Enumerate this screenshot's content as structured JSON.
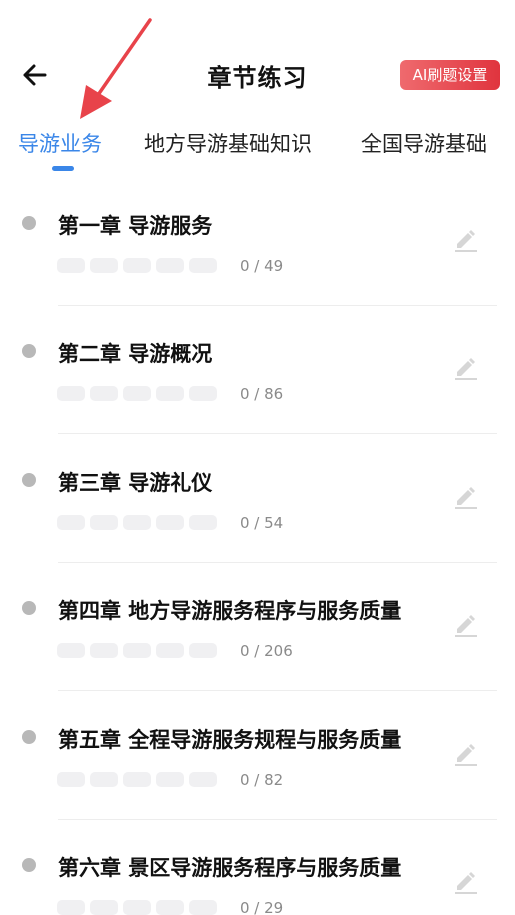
{
  "header": {
    "back_icon": "back-arrow-icon",
    "title": "章节练习",
    "ai_button": "AI刷题设置",
    "ai_button_color": "#e0343e"
  },
  "tabs": [
    {
      "label": "导游业务",
      "active": true
    },
    {
      "label": "地方导游基础知识",
      "active": false
    },
    {
      "label": "全国导游基础",
      "active": false
    }
  ],
  "accent_color": "#3a86e8",
  "chapters": [
    {
      "title": "第一章 导游服务",
      "count": "0 / 49"
    },
    {
      "title": "第二章 导游概况",
      "count": "0 / 86"
    },
    {
      "title": "第三章 导游礼仪",
      "count": "0 / 54"
    },
    {
      "title": "第四章 地方导游服务程序与服务质量",
      "count": "0 / 206"
    },
    {
      "title": "第五章 全程导游服务规程与服务质量",
      "count": "0 / 82"
    },
    {
      "title": "第六章 景区导游服务程序与服务质量",
      "count": "0 / 29"
    }
  ],
  "annotation": {
    "icon": "red-arrow-annotation",
    "color": "#e8434a"
  }
}
